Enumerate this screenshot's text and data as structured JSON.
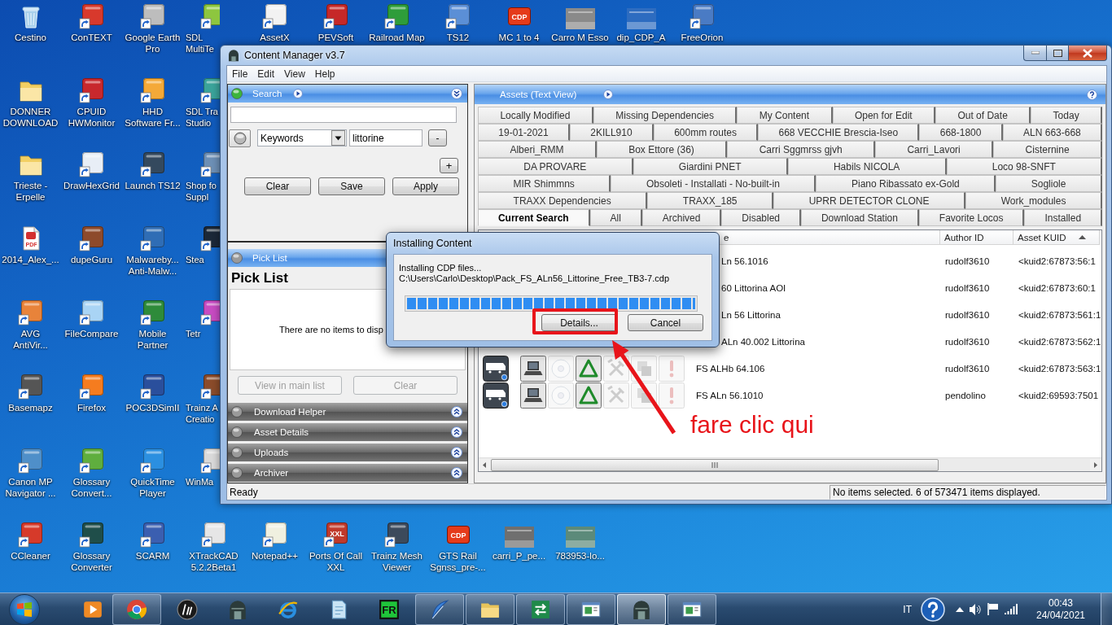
{
  "desktop_rows": [
    [
      {
        "label": "Cestino",
        "kind": "bin",
        "color": "#a8d0ec"
      },
      {
        "label": "ConTEXT",
        "kind": "app",
        "color": "#d8392c"
      },
      {
        "label": "Google Earth\nPro",
        "kind": "app",
        "color": "#bdbdbd"
      },
      {
        "label": "SDL\nMultiTe",
        "kind": "app",
        "color": "#8dc63f"
      },
      {
        "label": "AssetX",
        "kind": "app",
        "color": "#f2f2f2"
      },
      {
        "label": "PEVSoft",
        "kind": "app",
        "color": "#c62828"
      },
      {
        "label": "Railroad Map",
        "kind": "app",
        "color": "#2e9d3a"
      },
      {
        "label": "TS12",
        "kind": "app",
        "color": "#5b8fd6"
      },
      {
        "label": "MC 1 to 4",
        "kind": "file",
        "color": "#e53b1a",
        "icon_text": "CDP"
      },
      {
        "label": "Carro M Esso",
        "kind": "image",
        "color": "#8a8a8a"
      },
      {
        "label": "dip_CDP_A",
        "kind": "image",
        "color": "#2d6cc0"
      },
      {
        "label": "FreeOrion",
        "kind": "app",
        "color": "#4a7bc4"
      }
    ],
    [
      {
        "label": "DONNER\nDOWNLOAD",
        "kind": "folder",
        "color": "#f2cf63"
      },
      {
        "label": "CPUID\nHWMonitor",
        "kind": "app",
        "color": "#c8282d"
      },
      {
        "label": "HHD\nSoftware Fr...",
        "kind": "app",
        "color": "#f4a938"
      },
      {
        "label": "SDL Tra\nStudio",
        "kind": "app",
        "color": "#3aa39a"
      }
    ],
    [
      {
        "label": "Trieste -\nErpelle",
        "kind": "folder",
        "color": "#f2cf63"
      },
      {
        "label": "DrawHexGrid",
        "kind": "app",
        "color": "#e8eef6"
      },
      {
        "label": "Launch TS12",
        "kind": "app",
        "color": "#34495e"
      },
      {
        "label": "Shop fo\nSuppl",
        "kind": "app",
        "color": "#6d8fb5"
      }
    ],
    [
      {
        "label": "2014_Alex_...",
        "kind": "document",
        "color": "#d32f2f",
        "icon_text": "PDF"
      },
      {
        "label": "dupeGuru",
        "kind": "app",
        "color": "#8d4a2b"
      },
      {
        "label": "Malwareby...\nAnti-Malw...",
        "kind": "app",
        "color": "#2f6db5"
      },
      {
        "label": "Stea",
        "kind": "app",
        "color": "#1b2838"
      }
    ],
    [
      {
        "label": "AVG\nAntiVir...",
        "kind": "app",
        "color": "#e8833a"
      },
      {
        "label": "FileCompare",
        "kind": "app",
        "color": "#a9d4f5"
      },
      {
        "label": "Mobile\nPartner",
        "kind": "app",
        "color": "#2e8b3a"
      },
      {
        "label": "Tetr",
        "kind": "app",
        "color": "#c74bc2"
      }
    ],
    [
      {
        "label": "Basemapz",
        "kind": "app",
        "color": "#555555"
      },
      {
        "label": "Firefox",
        "kind": "app",
        "color": "#f57c1f"
      },
      {
        "label": "POC3DSimII",
        "kind": "app",
        "color": "#2a4f9c"
      },
      {
        "label": "Trainz A\nCreatio",
        "kind": "app",
        "color": "#8a4b2a"
      }
    ],
    [
      {
        "label": "Canon MP\nNavigator ...",
        "kind": "app",
        "color": "#4f8fc9"
      },
      {
        "label": "Glossary\nConvert...",
        "kind": "app",
        "color": "#5fae3e"
      },
      {
        "label": "QuickTime\nPlayer",
        "kind": "app",
        "color": "#2b8fe0"
      },
      {
        "label": "WinMa",
        "kind": "app",
        "color": "#d9d9d9"
      }
    ],
    [
      {
        "label": "CCleaner",
        "kind": "app",
        "color": "#d63a2a"
      },
      {
        "label": "Glossary\nConverter",
        "kind": "app",
        "color": "#1f4e4a"
      },
      {
        "label": "SCARM",
        "kind": "app",
        "color": "#3b5fb0"
      },
      {
        "label": "XTrackCAD\n5.2.2Beta1",
        "kind": "app",
        "color": "#e6e6e6"
      },
      {
        "label": "Notepad++",
        "kind": "app",
        "color": "#f0f0e0"
      },
      {
        "label": "Ports Of Call\nXXL",
        "kind": "app",
        "color": "#c0392b",
        "icon_text": "XXL"
      },
      {
        "label": "Trainz Mesh\nViewer",
        "kind": "app",
        "color": "#3c4a5c"
      },
      {
        "label": "GTS Rail\nSgnss_pre-...",
        "kind": "file",
        "color": "#e53b1a",
        "icon_text": "CDP"
      },
      {
        "label": "carri_P_pe...",
        "kind": "image",
        "color": "#6f6f6f"
      },
      {
        "label": "783953-lo...",
        "kind": "image",
        "color": "#5c8a7a"
      }
    ]
  ],
  "window": {
    "title": "Content Manager v3.7",
    "menu": [
      "File",
      "Edit",
      "View",
      "Help"
    ],
    "search_panel": {
      "title": "Search",
      "active": true,
      "expanded": true,
      "filter": {
        "field": "Keywords",
        "value": "littorine"
      },
      "remove_button": "-",
      "add_button": "+",
      "buttons": [
        "Clear",
        "Save",
        "Apply"
      ]
    },
    "pick_list": {
      "title": "Pick List",
      "active": false,
      "expanded": true,
      "heading": "Pick List",
      "empty_text": "There are no items to disp",
      "buttons": [
        {
          "label": "View in main list",
          "disabled": true
        },
        {
          "label": "Clear",
          "disabled": true
        }
      ]
    },
    "panels": [
      {
        "title": "Download Helper",
        "active": false,
        "expanded": false
      },
      {
        "title": "Asset Details",
        "active": false,
        "expanded": false
      },
      {
        "title": "Uploads",
        "active": false,
        "expanded": false
      },
      {
        "title": "Archiver",
        "active": false,
        "expanded": false
      }
    ],
    "assets": {
      "title": "Assets (Text View)",
      "tab_rows": [
        [
          {
            "label": "Locally Modified",
            "selected": false
          },
          {
            "label": "Missing Dependencies",
            "selected": false
          },
          {
            "label": "My Content",
            "selected": false
          },
          {
            "label": "Open for Edit",
            "selected": false
          },
          {
            "label": "Out of Date",
            "selected": false
          },
          {
            "label": "Today",
            "selected": false
          }
        ],
        [
          {
            "label": "19-01-2021",
            "selected": false
          },
          {
            "label": "2KILL910",
            "selected": false
          },
          {
            "label": "600mm routes",
            "selected": false
          },
          {
            "label": "668 VECCHIE Brescia-Iseo",
            "selected": false
          },
          {
            "label": "668-1800",
            "selected": false
          },
          {
            "label": "ALN 663-668",
            "selected": false
          }
        ],
        [
          {
            "label": "Alberi_RMM",
            "selected": false
          },
          {
            "label": "Box Ettore (36)",
            "selected": false
          },
          {
            "label": "Carri Sggmrss gjvh",
            "selected": false
          },
          {
            "label": "Carri_Lavori",
            "selected": false
          },
          {
            "label": "Cisternine",
            "selected": false
          }
        ],
        [
          {
            "label": "DA PROVARE",
            "selected": false
          },
          {
            "label": "Giardini PNET",
            "selected": false
          },
          {
            "label": "Habils NICOLA",
            "selected": false
          },
          {
            "label": "Loco 98-SNFT",
            "selected": false
          }
        ],
        [
          {
            "label": "MIR Shimmns",
            "selected": false
          },
          {
            "label": "Obsoleti - Installati - No-built-in",
            "selected": false
          },
          {
            "label": "Piano Ribassato ex-Gold",
            "selected": false
          },
          {
            "label": "Sogliole",
            "selected": false
          }
        ],
        [
          {
            "label": "TRAXX Dependencies",
            "selected": false
          },
          {
            "label": "TRAXX_185",
            "selected": false
          },
          {
            "label": "UPRR DETECTOR CLONE",
            "selected": false
          },
          {
            "label": "Work_modules",
            "selected": false
          }
        ],
        [
          {
            "label": "Current Search",
            "selected": true
          },
          {
            "label": "All",
            "selected": false
          },
          {
            "label": "Archived",
            "selected": false
          },
          {
            "label": "Disabled",
            "selected": false
          },
          {
            "label": "Download Station",
            "selected": false
          },
          {
            "label": "Favorite Locos",
            "selected": false
          },
          {
            "label": "Installed",
            "selected": false
          }
        ]
      ],
      "table": {
        "columns": [
          {
            "label": "e",
            "sorted": false
          },
          {
            "label": "Author ID",
            "sorted": false
          },
          {
            "label": "Asset KUID",
            "sorted": true
          }
        ],
        "rows": [
          {
            "kind": "partial",
            "name": "Ln 56.1016",
            "author": "rudolf3610",
            "kuid": "<kuid2:67873:56:1"
          },
          {
            "kind": "partial",
            "name": "60 Littorina AOI",
            "author": "rudolf3610",
            "kuid": "<kuid2:67873:60:1"
          },
          {
            "kind": "partial",
            "name": "Ln 56 Littorina",
            "author": "rudolf3610",
            "kuid": "<kuid2:67873:561:1"
          },
          {
            "kind": "partial",
            "name": "ALn 40.002 Littorina",
            "author": "rudolf3610",
            "kuid": "<kuid2:67873:562:1"
          },
          {
            "kind": "full",
            "name": "FS ALHb 64.106",
            "author": "rudolf3610",
            "kuid": "<kuid2:67873:563:1",
            "flags": [
              {
                "kind": "laptop",
                "on": true
              },
              {
                "kind": "disc",
                "on": false
              },
              {
                "kind": "triangle",
                "on": true
              },
              {
                "kind": "tools",
                "on": false
              },
              {
                "kind": "square",
                "on": false
              },
              {
                "kind": "alert",
                "on": false
              }
            ]
          },
          {
            "kind": "full",
            "name": "FS ALn 56.1010",
            "author": "pendolino",
            "kuid": "<kuid2:69593:7501",
            "flags": [
              {
                "kind": "laptop",
                "on": true
              },
              {
                "kind": "disc",
                "on": false
              },
              {
                "kind": "triangle",
                "on": true
              },
              {
                "kind": "tools",
                "on": false
              },
              {
                "kind": "square",
                "on": false
              },
              {
                "kind": "alert",
                "on": false
              }
            ]
          }
        ]
      }
    },
    "status_bar": {
      "left": "Ready",
      "right": "No items selected. 6 of 573471 items displayed."
    }
  },
  "dialog": {
    "title": "Installing Content",
    "message": "Installing CDP files...",
    "path": "C:\\Users\\Carlo\\Desktop\\Pack_FS_ALn56_Littorine_Free_TB3-7.cdp",
    "progress": {
      "level": 1
    },
    "buttons": [
      "Details...",
      "Cancel"
    ]
  },
  "annotation": {
    "text": "fare clic qui"
  },
  "taskbar": {
    "items": [
      {
        "kind": "player",
        "running": false,
        "selected": false
      },
      {
        "kind": "browser",
        "running": true,
        "selected": false
      },
      {
        "kind": "logo",
        "running": false,
        "selected": false
      },
      {
        "kind": "tower",
        "running": false,
        "selected": false
      },
      {
        "kind": "globe",
        "running": false,
        "selected": false
      },
      {
        "kind": "notepad",
        "running": false,
        "selected": false
      },
      {
        "kind": "badge",
        "running": false,
        "selected": false,
        "icon_text": "FR"
      },
      {
        "kind": "feather",
        "running": true,
        "selected": false
      },
      {
        "kind": "folder",
        "running": true,
        "selected": false
      },
      {
        "kind": "arrows",
        "running": true,
        "selected": false
      },
      {
        "kind": "window",
        "running": true,
        "selected": false
      },
      {
        "kind": "tower",
        "running": true,
        "selected": true
      },
      {
        "kind": "window",
        "running": true,
        "selected": false
      }
    ],
    "language": "IT",
    "time": "00:43",
    "date": "24/04/2021"
  }
}
